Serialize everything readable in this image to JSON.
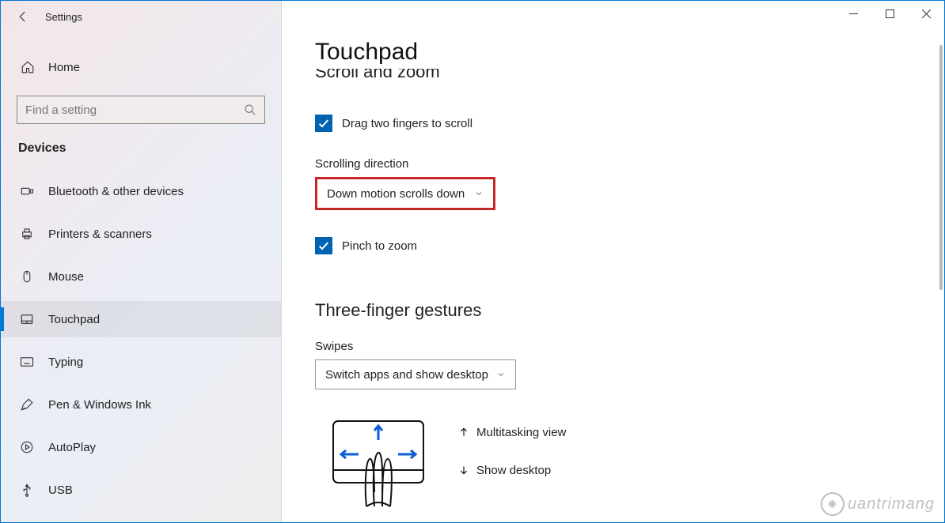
{
  "app_title": "Settings",
  "home_label": "Home",
  "search": {
    "placeholder": "Find a setting"
  },
  "section_title": "Devices",
  "sidebar_items": [
    {
      "label": "Bluetooth & other devices"
    },
    {
      "label": "Printers & scanners"
    },
    {
      "label": "Mouse"
    },
    {
      "label": "Touchpad"
    },
    {
      "label": "Typing"
    },
    {
      "label": "Pen & Windows Ink"
    },
    {
      "label": "AutoPlay"
    },
    {
      "label": "USB"
    }
  ],
  "page_title": "Touchpad",
  "cut_heading": "Scroll and zoom",
  "chk_drag": "Drag two fingers to scroll",
  "scroll_dir_label": "Scrolling direction",
  "scroll_dir_value": "Down motion scrolls down",
  "chk_pinch": "Pinch to zoom",
  "three_finger_heading": "Three-finger gestures",
  "swipes_label": "Swipes",
  "swipes_value": "Switch apps and show desktop",
  "legend_up": "Multitasking view",
  "legend_down": "Show desktop",
  "watermark": "uantrimang"
}
